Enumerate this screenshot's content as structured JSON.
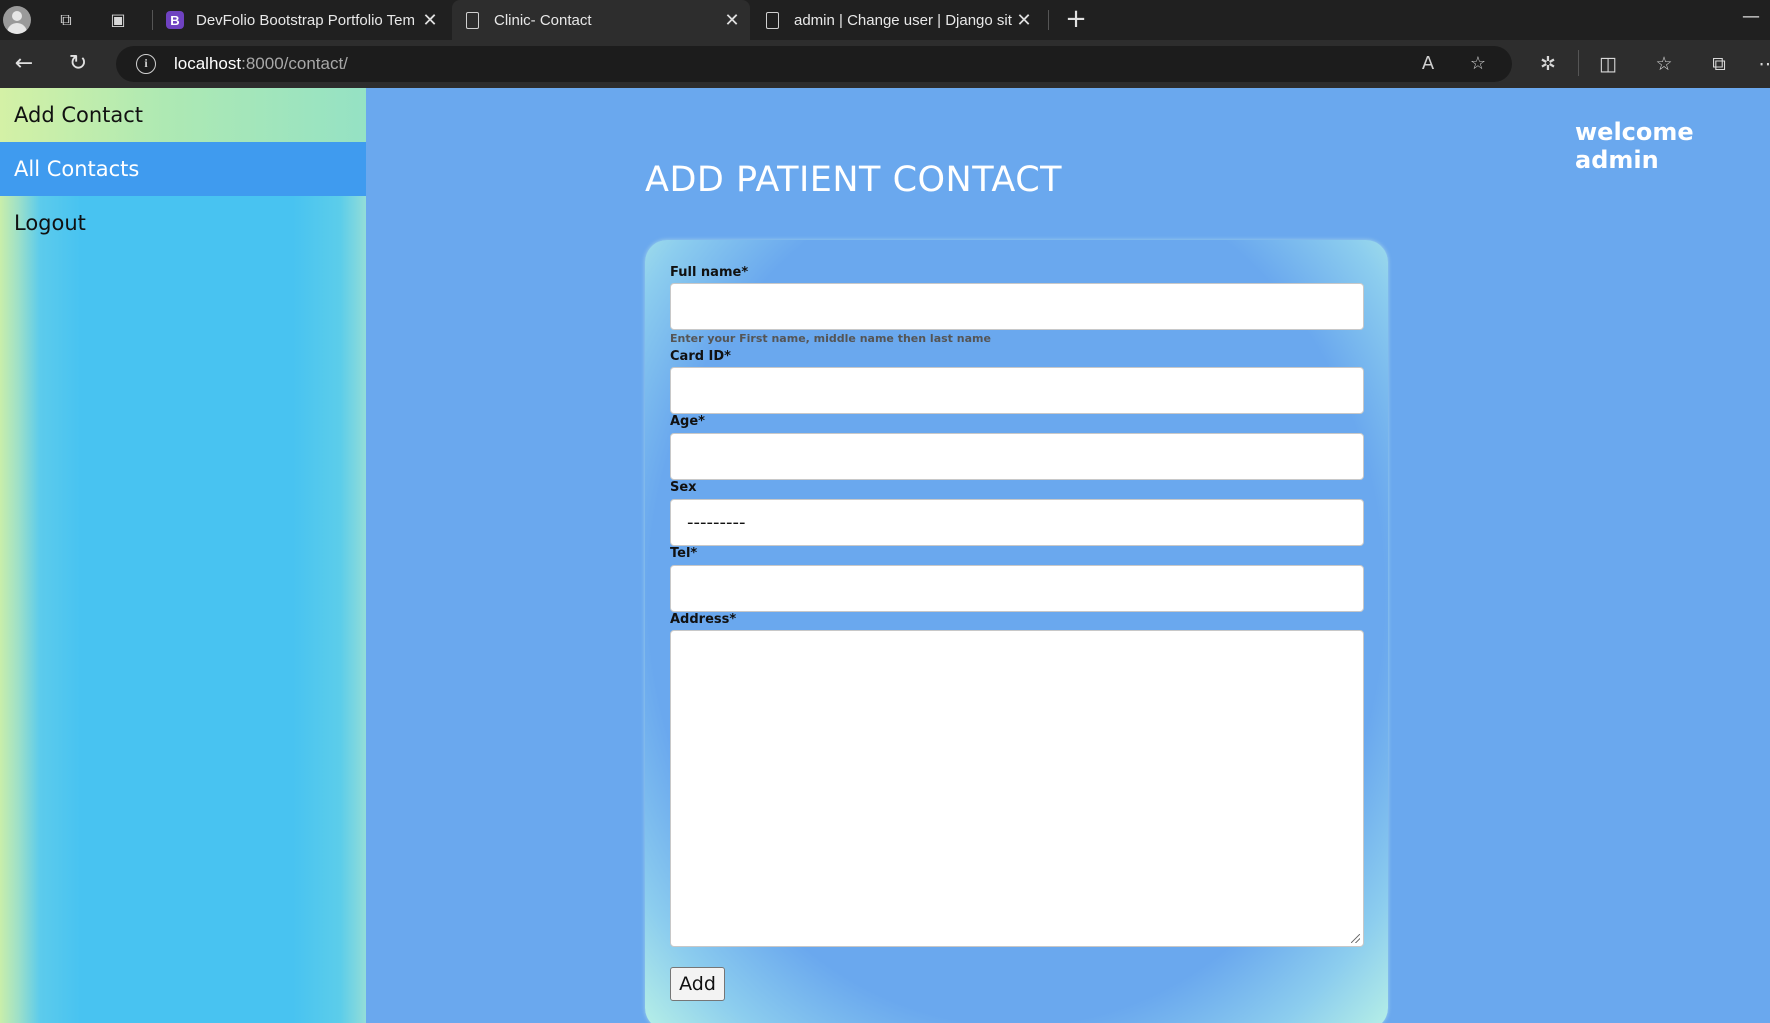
{
  "browser": {
    "tabs": [
      {
        "label": "DevFolio Bootstrap Portfolio Tem",
        "favicon": "bootstrap-b-icon",
        "favicon_text": "B"
      },
      {
        "label": "Clinic- Contact",
        "favicon": "page-icon",
        "active": true
      },
      {
        "label": "admin | Change user | Django sit",
        "favicon": "page-icon"
      }
    ],
    "url_host": "localhost",
    "url_path": ":8000/contact/"
  },
  "sidebar": {
    "items": [
      {
        "label": "Add Contact"
      },
      {
        "label": "All Contacts",
        "active": true
      },
      {
        "label": "Logout"
      }
    ]
  },
  "header": {
    "welcome": "welcome admin",
    "title": "ADD PATIENT CONTACT"
  },
  "form": {
    "full_name": {
      "label": "Full name*",
      "value": "",
      "help": "Enter your First name, middle name then last name"
    },
    "card_id": {
      "label": "Card ID*",
      "value": ""
    },
    "age": {
      "label": "Age*",
      "value": ""
    },
    "sex": {
      "label": "Sex",
      "value": "---------"
    },
    "tel": {
      "label": "Tel*",
      "value": ""
    },
    "address": {
      "label": "Address*",
      "value": ""
    },
    "submit_label": "Add"
  },
  "colors": {
    "page_bg": "#6aa8ee",
    "sidebar_bg": "#48c3f1",
    "sidebar_active": "#3f9bef"
  }
}
